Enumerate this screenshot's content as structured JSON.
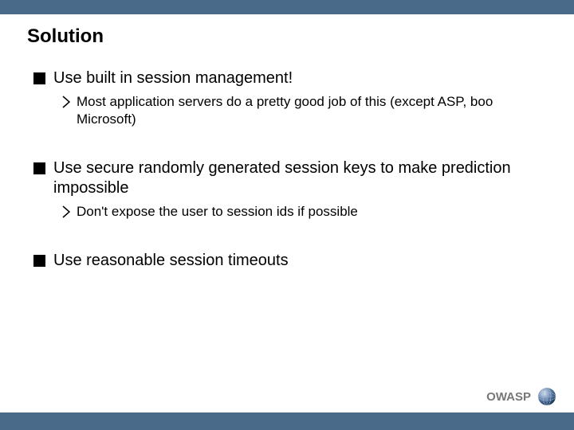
{
  "title": "Solution",
  "bullets": [
    {
      "text": "Use built in session management!",
      "sub": [
        "Most application servers do a pretty good job of this (except ASP, boo Microsoft)"
      ]
    },
    {
      "text": "Use secure randomly generated session keys to make prediction impossible",
      "sub": [
        "Don't expose the user to session ids if possible"
      ]
    },
    {
      "text": "Use reasonable session timeouts",
      "sub": []
    }
  ],
  "brand": "OWASP",
  "colors": {
    "bar": "#4a6a8a"
  }
}
